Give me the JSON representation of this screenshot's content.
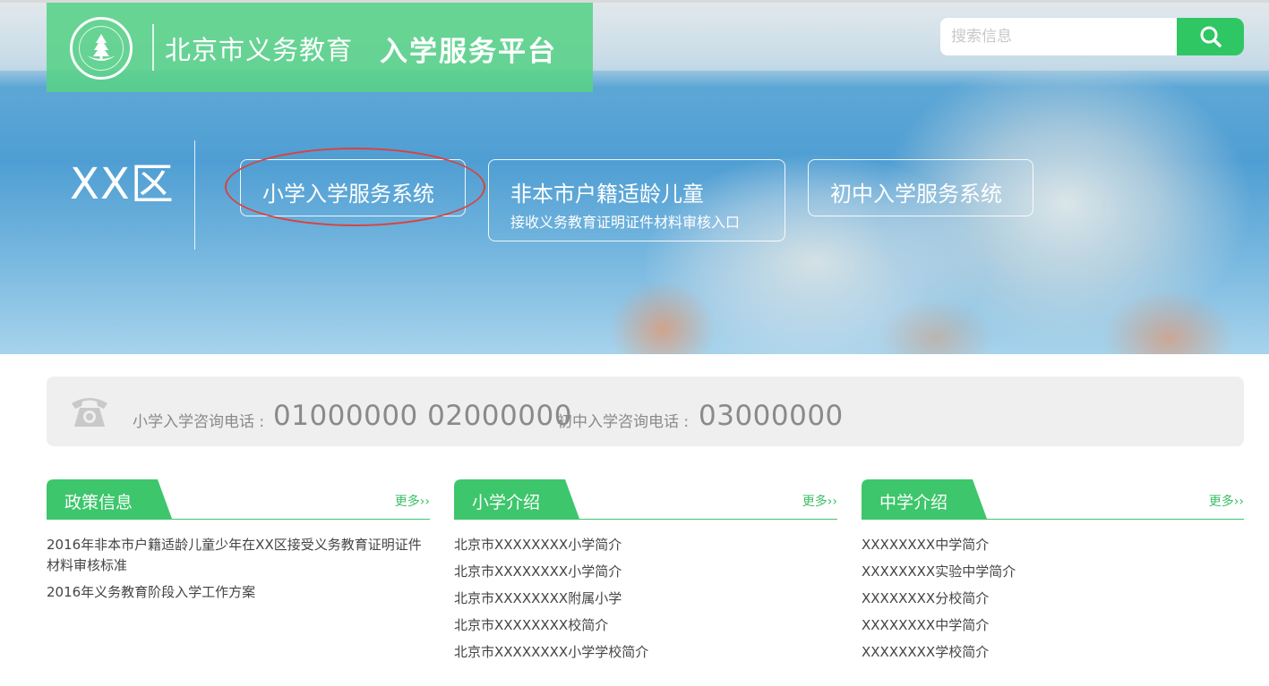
{
  "header": {
    "logo_title": "北京市义务教育",
    "logo_subtitle": "入学服务平台",
    "search_placeholder": "搜索信息"
  },
  "hero": {
    "district": "XX区",
    "buttons": {
      "primary": "小学入学服务系统",
      "nonlocal_title": "非本市户籍适龄儿童",
      "nonlocal_subtitle": "接收义务教育证明证件材料审核入口",
      "middle": "初中入学服务系统"
    }
  },
  "hotline": {
    "primary_label": "小学入学咨询电话 :",
    "primary_numbers": "01000000 02000000",
    "middle_label": "初中入学咨询电话 :",
    "middle_number": "03000000"
  },
  "panels": {
    "policy": {
      "title": "政策信息",
      "more": "更多››",
      "items": [
        "2016年非本市户籍适龄儿童少年在XX区接受义务教育证明证件材料审核标准",
        "2016年义务教育阶段入学工作方案"
      ]
    },
    "primary": {
      "title": "小学介绍",
      "more": "更多››",
      "items": [
        "北京市XXXXXXXX小学简介",
        "北京市XXXXXXXX小学简介",
        "北京市XXXXXXXX附属小学",
        "北京市XXXXXXXX校简介",
        "北京市XXXXXXXX小学学校简介"
      ]
    },
    "middle": {
      "title": "中学介绍",
      "more": "更多››",
      "items": [
        "XXXXXXXX中学简介",
        "XXXXXXXX实验中学简介",
        "XXXXXXXX分校简介",
        "XXXXXXXX中学简介",
        "XXXXXXXX学校简介"
      ]
    }
  },
  "colors": {
    "brand_green": "#2fc763",
    "annotation_red": "#d9433e",
    "text_gray": "#8a8a8a"
  },
  "icons": {
    "search": "search-icon",
    "phone": "phone-icon",
    "logo": "logo-emblem-icon"
  }
}
